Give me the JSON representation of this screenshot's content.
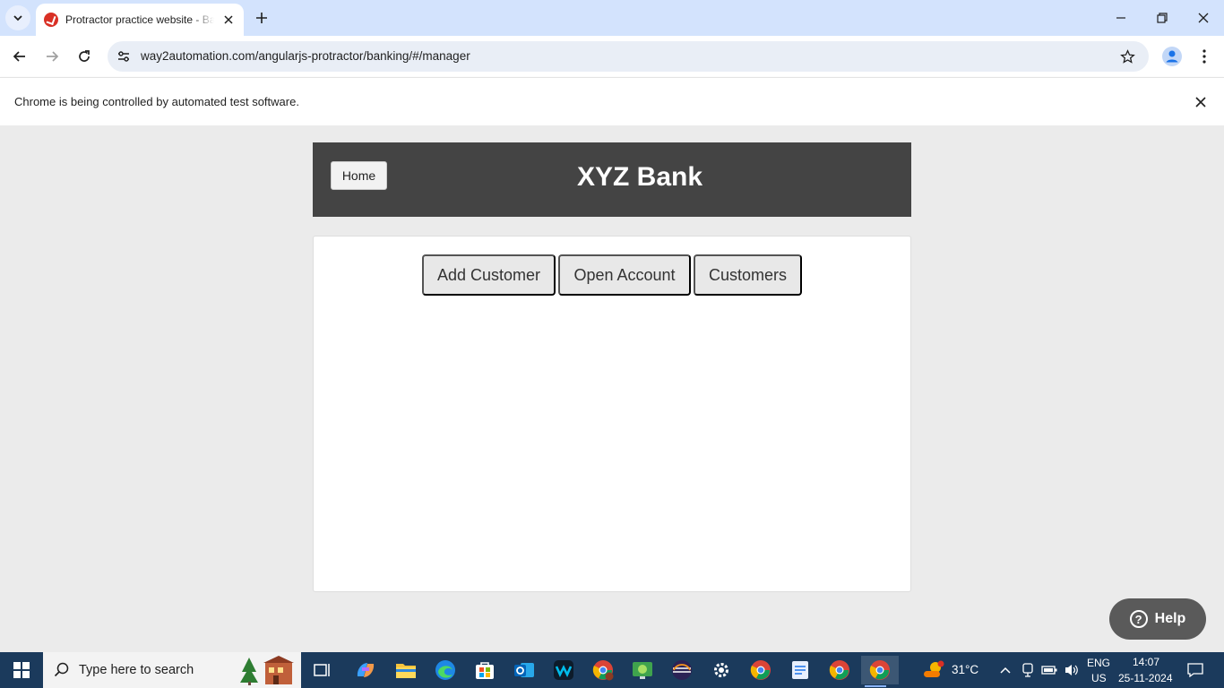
{
  "browser": {
    "tab_title": "Protractor practice website - Banking App",
    "url": "way2automation.com/angularjs-protractor/banking/#/manager",
    "infobar_text": "Chrome is being controlled by automated test software."
  },
  "page": {
    "home_label": "Home",
    "bank_title": "XYZ Bank",
    "manager_buttons": [
      "Add Customer",
      "Open Account",
      "Customers"
    ],
    "help_label": "Help"
  },
  "taskbar": {
    "search_placeholder": "Type here to search",
    "weather": "31°C",
    "language_line1": "ENG",
    "language_line2": "US",
    "time": "14:07",
    "date": "25-11-2024",
    "apps": [
      "task-view",
      "copilot",
      "file-explorer",
      "edge",
      "store",
      "outlook",
      "webex",
      "chrome-profile",
      "image-viewer",
      "eclipse",
      "settings",
      "chrome",
      "notepad",
      "chrome-2",
      "chrome-active"
    ]
  },
  "colors": {
    "bank_header": "#444444",
    "page_bg": "#ebebeb",
    "tabstrip": "#d3e3fd",
    "taskbar": "#1b3a5c"
  }
}
